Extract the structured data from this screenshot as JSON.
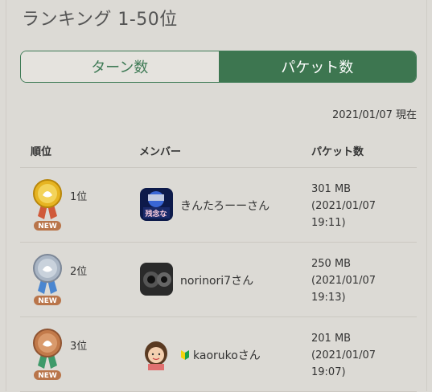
{
  "title": "ランキング 1-50位",
  "tabs": {
    "turns": "ターン数",
    "packets": "パケット数"
  },
  "date": "2021/01/07 現在",
  "headers": {
    "rank": "順位",
    "member": "メンバー",
    "packets": "パケット数"
  },
  "rows": [
    {
      "rank": "1位",
      "badge": "NEW",
      "name": "きんたろーーさん",
      "packets": "301 MB",
      "date": "(2021/01/07",
      "time": "19:11)",
      "medal": "gold-medal-icon",
      "avatar_text": "残念な"
    },
    {
      "rank": "2位",
      "badge": "NEW",
      "name": "norinori7さん",
      "packets": "250 MB",
      "date": "(2021/01/07",
      "time": "19:13)",
      "medal": "silver-medal-icon"
    },
    {
      "rank": "3位",
      "badge": "NEW",
      "name": "kaorukoさん",
      "packets": "201 MB",
      "date": "(2021/01/07",
      "time": "19:07)",
      "medal": "bronze-medal-icon"
    }
  ],
  "colors": {
    "accent": "#3d7650",
    "gold": "#e6b422",
    "silver": "#a9b5c4",
    "bronze": "#c27a4a",
    "badge": "#b9754a"
  }
}
